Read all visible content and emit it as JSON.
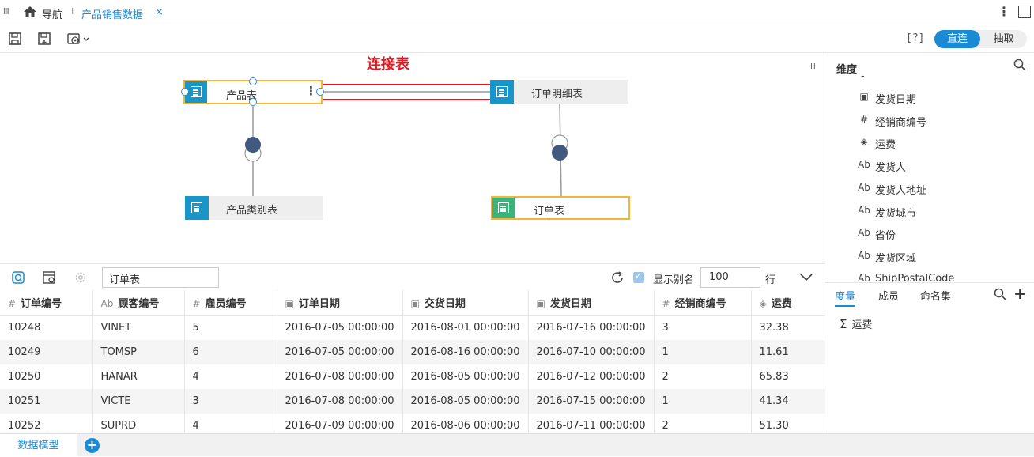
{
  "topbar": {
    "nav_label": "导航",
    "separator": "I",
    "active_tab": "产品销售数据",
    "close_glyph": "×"
  },
  "toolbar": {
    "help": "[?]",
    "mode_direct": "直连",
    "mode_extract": "抽取"
  },
  "canvas": {
    "annotation": "连接表",
    "tables": {
      "product": "产品表",
      "order_detail": "订单明细表",
      "category": "产品类别表",
      "order": "订单表"
    }
  },
  "data_toolbar": {
    "filter_value": "订单表",
    "show_alias_label": "显示别名",
    "show_alias_checked": true,
    "rows_value": "100",
    "rows_unit": "行"
  },
  "grid": {
    "columns": [
      {
        "type": "#",
        "label": "订单编号"
      },
      {
        "type": "Ab",
        "label": "顾客编号"
      },
      {
        "type": "#",
        "label": "雇员编号"
      },
      {
        "type": "date",
        "label": "订单日期"
      },
      {
        "type": "date",
        "label": "交货日期"
      },
      {
        "type": "date",
        "label": "发货日期"
      },
      {
        "type": "#",
        "label": "经销商编号"
      },
      {
        "type": "eye",
        "label": "运费"
      }
    ],
    "rows": [
      [
        "10248",
        "VINET",
        "5",
        "2016-07-05 00:00:00",
        "2016-08-01 00:00:00",
        "2016-07-16 00:00:00",
        "3",
        "32.38"
      ],
      [
        "10249",
        "TOMSP",
        "6",
        "2016-07-05 00:00:00",
        "2016-08-16 00:00:00",
        "2016-07-10 00:00:00",
        "1",
        "11.61"
      ],
      [
        "10250",
        "HANAR",
        "4",
        "2016-07-08 00:00:00",
        "2016-08-05 00:00:00",
        "2016-07-12 00:00:00",
        "2",
        "65.83"
      ],
      [
        "10251",
        "VICTE",
        "3",
        "2016-07-08 00:00:00",
        "2016-08-05 00:00:00",
        "2016-07-15 00:00:00",
        "1",
        "41.34"
      ],
      [
        "10252",
        "SUPRD",
        "4",
        "2016-07-09 00:00:00",
        "2016-08-06 00:00:00",
        "2016-07-11 00:00:00",
        "2",
        "51.30"
      ]
    ]
  },
  "right_panel": {
    "dimension_title": "维度",
    "dimensions": [
      {
        "type": "date",
        "label": "发货日期"
      },
      {
        "type": "#",
        "label": "经销商编号"
      },
      {
        "type": "eye",
        "label": "运费"
      },
      {
        "type": "Ab",
        "label": "发货人"
      },
      {
        "type": "Ab",
        "label": "发货人地址"
      },
      {
        "type": "Ab",
        "label": "发货城市"
      },
      {
        "type": "Ab",
        "label": "省份"
      },
      {
        "type": "Ab",
        "label": "发货区域"
      },
      {
        "type": "Ab",
        "label": "ShipPostalCode"
      }
    ],
    "tabs": [
      "度量",
      "成员",
      "命名集"
    ],
    "measures": [
      {
        "type": "sum",
        "label": "运费"
      }
    ]
  },
  "bottom": {
    "model_tab": "数据模型",
    "add_glyph": "+"
  },
  "colors": {
    "accent": "#1a8ad4",
    "annotation_red": "#e4161e",
    "selection_orange": "#f5b52d",
    "table_icon": "#1896c9",
    "table_icon_green": "#3bb37b",
    "link_node": "#41597f"
  }
}
